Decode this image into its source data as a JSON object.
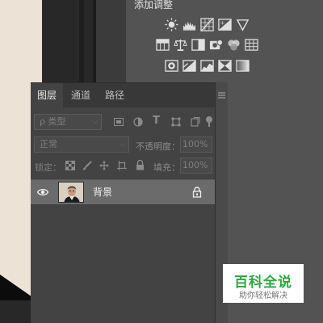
{
  "adjustments": {
    "title": "添加调整",
    "row1": [
      "brightness-contrast-icon",
      "levels-icon",
      "curves-icon",
      "exposure-icon",
      "vibrance-icon"
    ],
    "row2": [
      "hue-saturation-icon",
      "color-balance-icon",
      "black-white-icon",
      "photo-filter-icon",
      "channel-mixer-icon",
      "color-lookup-icon"
    ],
    "row3": [
      "invert-icon",
      "posterize-icon",
      "threshold-icon",
      "selective-color-icon",
      "gradient-map-icon"
    ]
  },
  "layers_panel": {
    "tabs": [
      "图层",
      "通道",
      "路径"
    ],
    "active_tab": "图层",
    "filter": {
      "placeholder": "ρ 类型"
    },
    "blend_mode": "正常",
    "opacity_label": "不透明度：",
    "opacity_value": "100%",
    "lock_label": "锁定：",
    "fill_label": "填充：",
    "fill_value": "100%",
    "layers": [
      {
        "name": "背景",
        "visible": true,
        "locked": true
      }
    ]
  },
  "watermark": {
    "title": "百科全说",
    "subtitle": "助你轻松解决"
  },
  "colors": {
    "panel_bg": "#535353",
    "layers_bg": "#434343",
    "selected_row": "#6b6b6b",
    "watermark_green": "#2aa844"
  }
}
